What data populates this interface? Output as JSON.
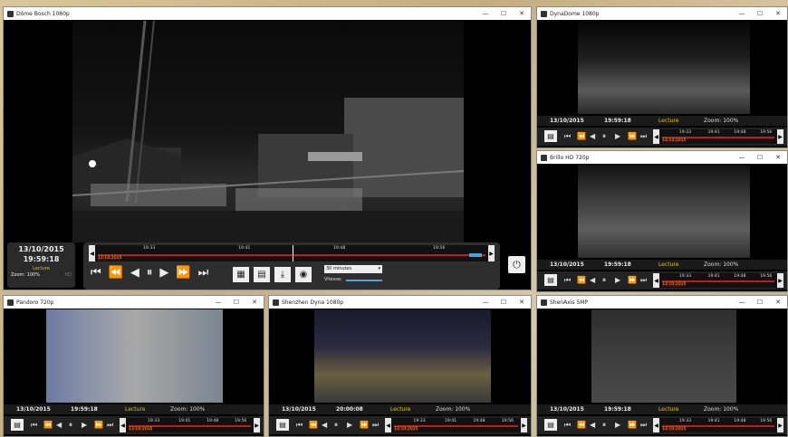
{
  "main": {
    "title": "Dôme Bosch 1080p",
    "date": "13/10/2015",
    "time": "19:59:18",
    "mode": "Lecture",
    "zoom": "Zoom: 100%",
    "badge": "HD",
    "timeline_labels": [
      "19:33",
      "19:41",
      "19:48",
      "19:56"
    ],
    "playhead_label": "13:10:2015",
    "speed_select": "30 minutes",
    "speed_label": "Vitesse:"
  },
  "cam2": {
    "title": "DynaDome 1080p",
    "mode": "Lecture",
    "zoom": "Zoom: 100%",
    "timeline_labels": [
      "19:33",
      "19:41",
      "19:48",
      "19:56"
    ],
    "playhead_label": "13:10:2015",
    "date": "13/10/2015",
    "time": "19:59:18"
  },
  "cam3": {
    "title": "Brillo HD 720p",
    "date": "13/10/2015",
    "time": "19:59:18",
    "mode": "Lecture",
    "zoom": "Zoom: 100%",
    "timeline_labels": [
      "19:33",
      "19:41",
      "19:48",
      "19:56"
    ],
    "playhead_label": "13:10:2015"
  },
  "cam4": {
    "title": "Pandoro 720p",
    "date": "13/10/2015",
    "time": "19:59:18",
    "mode": "Lecture",
    "zoom": "Zoom: 100%",
    "timeline_labels": [
      "19:33",
      "19:41",
      "19:48",
      "19:56"
    ],
    "playhead_label": "13:10:2015"
  },
  "cam5": {
    "title": "Shenzhen Dyna 1080p",
    "date": "13/10/2015",
    "time": "20:00:08",
    "mode": "Lecture",
    "zoom": "Zoom: 100%",
    "timeline_labels": [
      "19:33",
      "19:41",
      "19:48",
      "19:56"
    ],
    "playhead_label": "13:10:2015"
  },
  "cam6": {
    "title": "ShenAxis 5MP",
    "date": "13/10/2015",
    "time": "19:59:18",
    "mode": "Lecture",
    "zoom": "Zoom: 100%",
    "timeline_labels": [
      "19:33",
      "19:41",
      "19:48",
      "19:56"
    ],
    "playhead_label": "13:10:2015"
  },
  "window_buttons": {
    "minimize": "—",
    "maximize": "☐",
    "close": "✕"
  },
  "icons": [
    "skip-start-icon",
    "fast-backward-icon",
    "step-backward-icon",
    "pause-icon",
    "play-icon",
    "fast-forward-icon",
    "skip-end-icon",
    "grid-icon",
    "calendar-icon",
    "download-icon",
    "snapshot-icon",
    "power-icon"
  ]
}
